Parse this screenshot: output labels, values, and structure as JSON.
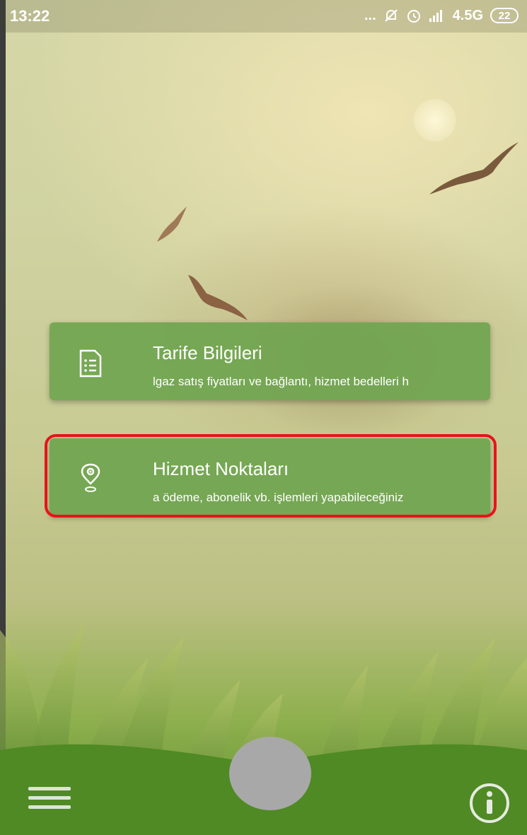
{
  "status_bar": {
    "time": "13:22",
    "dots": "...",
    "network": "4.5G",
    "battery": "22",
    "icons": [
      "mute-icon",
      "alarm-icon",
      "signal-icon"
    ]
  },
  "cards": [
    {
      "title": "Tarife Bilgileri",
      "subtitle": "lgaz satış fiyatları ve bağlantı, hizmet bedelleri h",
      "icon": "document-list-icon"
    },
    {
      "title": "Hizmet Noktaları",
      "subtitle": "a ödeme, abonelik vb. işlemleri yapabileceğiniz",
      "icon": "location-pin-icon",
      "highlighted": true
    }
  ],
  "highlight_color": "#e8131a",
  "card_color": "#70a550",
  "bottom_bar": {
    "left": "menu-icon",
    "center": "action-button",
    "right": "info-icon"
  }
}
